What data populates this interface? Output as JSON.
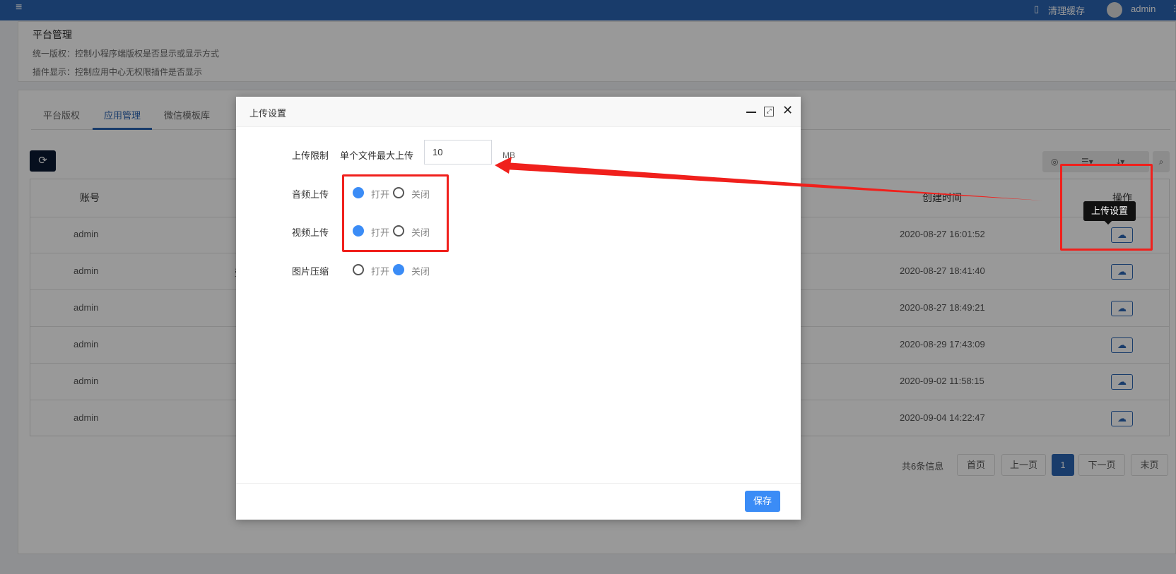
{
  "header": {
    "cache_label": "清理缓存",
    "user": "admin"
  },
  "notice": {
    "title": "平台管理",
    "lines": [
      "统一版权：控制小程序端版权是否显示或显示方式",
      "插件显示：控制应用中心无权限插件是否显示"
    ]
  },
  "tabs": [
    {
      "label": "平台版权"
    },
    {
      "label": "应用管理",
      "active": true
    },
    {
      "label": "微信模板库"
    }
  ],
  "table": {
    "columns": {
      "account": "账号",
      "created": "创建时间",
      "actions": "操作"
    },
    "rows": [
      {
        "account": "admin",
        "name": "",
        "created": "2020-08-27 16:01:52"
      },
      {
        "account": "admin",
        "name": "壹",
        "created": "2020-08-27 18:41:40"
      },
      {
        "account": "admin",
        "name": "",
        "created": "2020-08-27 18:49:21"
      },
      {
        "account": "admin",
        "name": "",
        "created": "2020-08-29 17:43:09"
      },
      {
        "account": "admin",
        "name": "",
        "created": "2020-09-02 11:58:15"
      },
      {
        "account": "admin",
        "name": "",
        "created": "2020-09-04 14:22:47"
      }
    ],
    "tooltip": "上传设置"
  },
  "pagination": {
    "total": "共6条信息",
    "first": "首页",
    "prev": "上一页",
    "current": "1",
    "next": "下一页",
    "last": "末页"
  },
  "modal": {
    "title": "上传设置",
    "upload_limit": {
      "label": "上传限制",
      "sub_label": "单个文件最大上传",
      "value": "10",
      "unit": "MB"
    },
    "audio": {
      "label": "音频上传",
      "on": "打开",
      "off": "关闭",
      "value": "on"
    },
    "video": {
      "label": "视频上传",
      "on": "打开",
      "off": "关闭",
      "value": "on"
    },
    "image": {
      "label": "图片压缩",
      "on": "打开",
      "off": "关闭",
      "value": "off"
    },
    "save": "保存"
  },
  "colors": {
    "primary": "#2a64b2",
    "radio": "#3b8cf6",
    "annotation": "#f0201c"
  }
}
